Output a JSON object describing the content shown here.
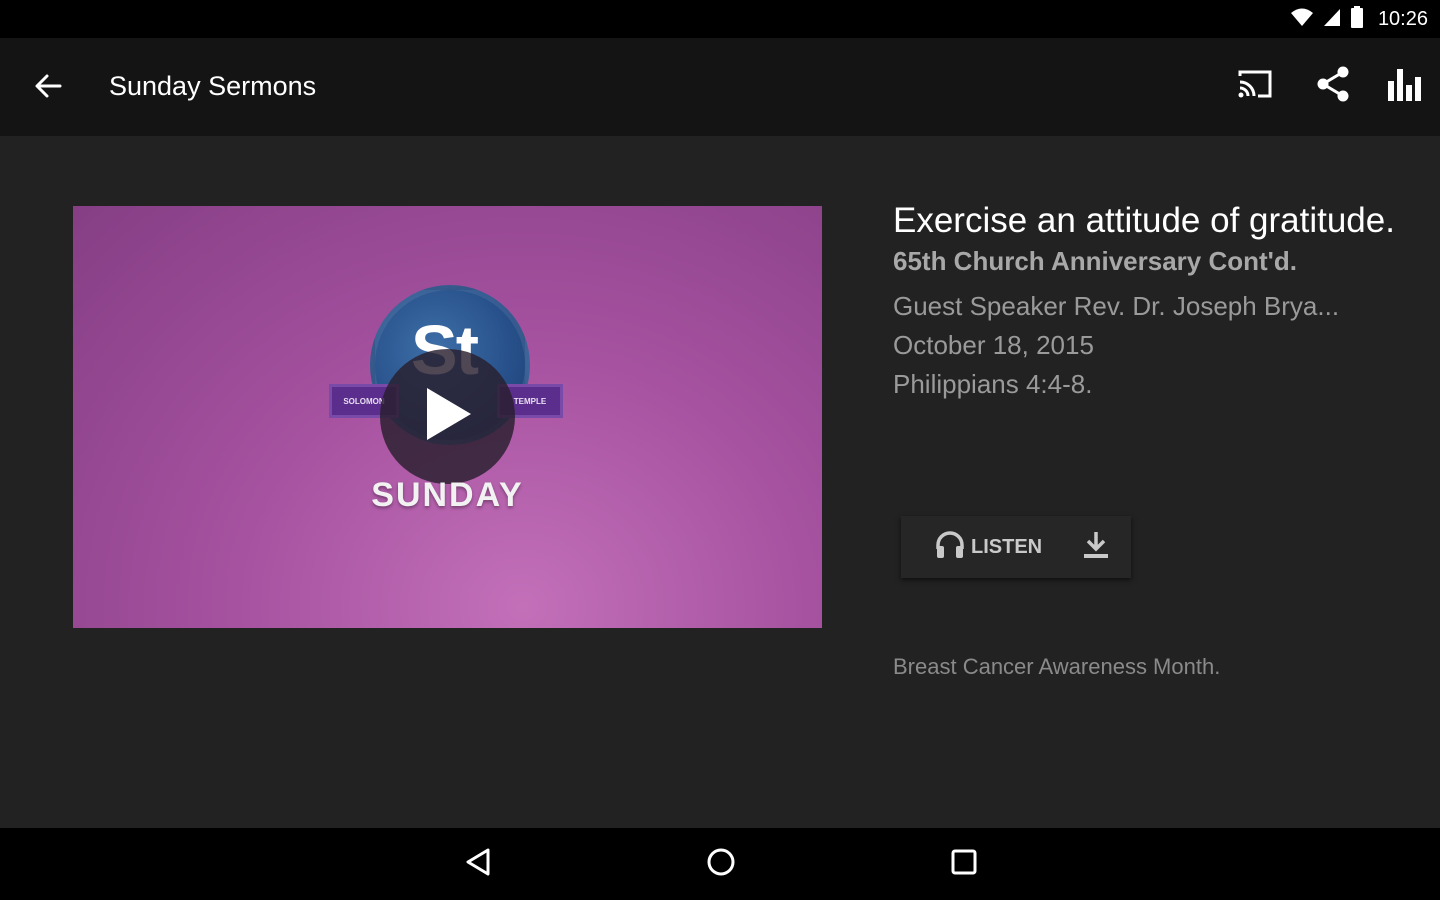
{
  "status_bar": {
    "time": "10:26",
    "icons": [
      "wifi-icon",
      "cell-signal-icon",
      "battery-icon"
    ]
  },
  "app_bar": {
    "title": "Sunday Sermons",
    "actions": [
      "cast-icon",
      "share-icon",
      "equalizer-icon"
    ]
  },
  "media": {
    "thumbnail_text": "SUNDAY",
    "logo_text": "St",
    "ribbon_left": "SOLOMON",
    "ribbon_right": "TEMPLE"
  },
  "sermon": {
    "title": "Exercise an attitude of gratitude.",
    "subtitle": "65th  Church Anniversary Cont'd.",
    "speaker": "Guest Speaker  Rev. Dr. Joseph Brya...",
    "date": "October 18, 2015",
    "scripture": "Philippians 4:4-8."
  },
  "actions": {
    "listen_label": "LISTEN"
  },
  "note": "Breast Cancer Awareness Month.",
  "colors": {
    "background": "#222222",
    "app_bar": "#141414",
    "thumbnail_purple": "#a652a0"
  }
}
